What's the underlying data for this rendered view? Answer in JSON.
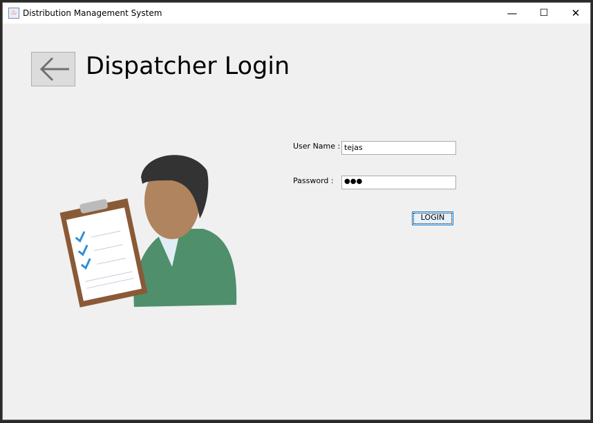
{
  "window": {
    "title": "Distribution Management System",
    "minimize": "—",
    "maximize": "☐",
    "close": "✕"
  },
  "header": {
    "back_icon": "arrow-left-icon",
    "title": "Dispatcher Login"
  },
  "form": {
    "username_label": "User Name :",
    "username_value": "tejas",
    "password_label": "Password :",
    "password_value": "●●●",
    "login_label": "LOGIN"
  }
}
